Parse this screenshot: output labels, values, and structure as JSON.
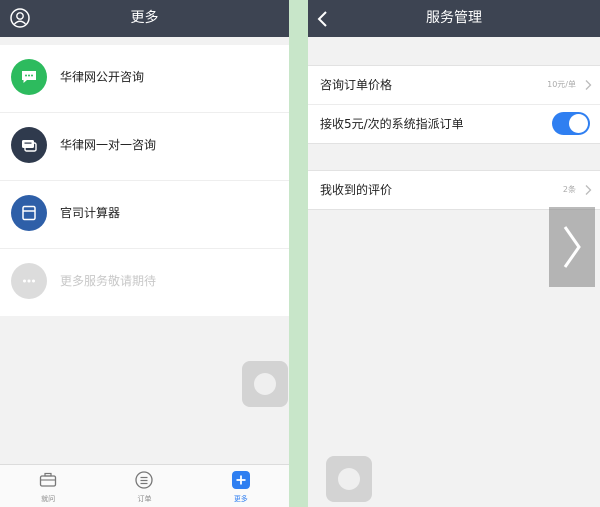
{
  "left": {
    "title": "更多",
    "menu": [
      {
        "label": "华律网公开咨询",
        "icon": "chat-bubble-icon",
        "color": "#2dbb5e"
      },
      {
        "label": "华律网一对一咨询",
        "icon": "consult-icon",
        "color": "#2f3a4d"
      },
      {
        "label": "官司计算器",
        "icon": "calculator-icon",
        "color": "#2e5fa8"
      },
      {
        "label": "更多服务敬请期待",
        "icon": "more-dots-icon",
        "color": "#dcdcdc"
      }
    ],
    "tabs": [
      {
        "label": "就问",
        "icon": "briefcase-icon"
      },
      {
        "label": "订单",
        "icon": "list-icon"
      },
      {
        "label": "更多",
        "icon": "plus-icon",
        "active": true
      }
    ]
  },
  "right": {
    "title": "服务管理",
    "group1": [
      {
        "label": "咨询订单价格",
        "value": "10元/单"
      },
      {
        "label": "接收5元/次的系统指派订单",
        "toggle": true
      }
    ],
    "group2": [
      {
        "label": "我收到的评价",
        "value": "2条"
      }
    ]
  },
  "colors": {
    "navbar": "#3d4452",
    "accent": "#2f7ff1",
    "divider": "#c8e6c9"
  }
}
